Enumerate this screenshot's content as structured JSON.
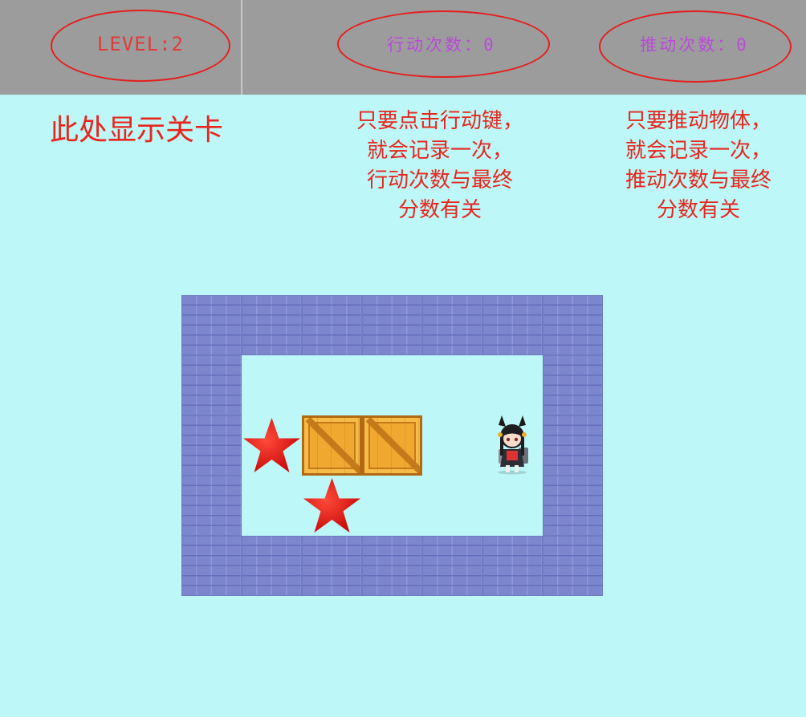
{
  "header": {
    "level_text": "LEVEL:2",
    "moves_text": "行动次数：0",
    "pushes_text": "推动次数：0"
  },
  "notes": {
    "level_note": [
      "此处显示关卡"
    ],
    "moves_note": [
      "只要点击行动键，",
      "就会记录一次，",
      "行动次数与最终",
      "分数有关"
    ],
    "pushes_note": [
      "只要推动物体，",
      "就会记录一次，",
      "推动次数与最终",
      "分数有关"
    ]
  },
  "game": {
    "level": 2,
    "moves": 0,
    "pushes": 0,
    "grid_cols": 7,
    "grid_rows": 5,
    "tiles": [
      "WWWWWWW",
      "W.....W",
      "WTBB.PW",
      "W.T...W",
      "WWWWWWW"
    ],
    "legend": {
      "W": "wall",
      ".": "floor",
      "T": "target-star",
      "B": "crate",
      "P": "player"
    }
  },
  "colors": {
    "header_bg": "#9c9c9c",
    "page_bg": "#bdf7f7",
    "annotation_red": "#e8261e",
    "counter_purple": "#b94bd6",
    "level_red": "#e23a3a",
    "wall": "#7b86cc",
    "crate": "#f0a830",
    "star": "#e01515"
  }
}
